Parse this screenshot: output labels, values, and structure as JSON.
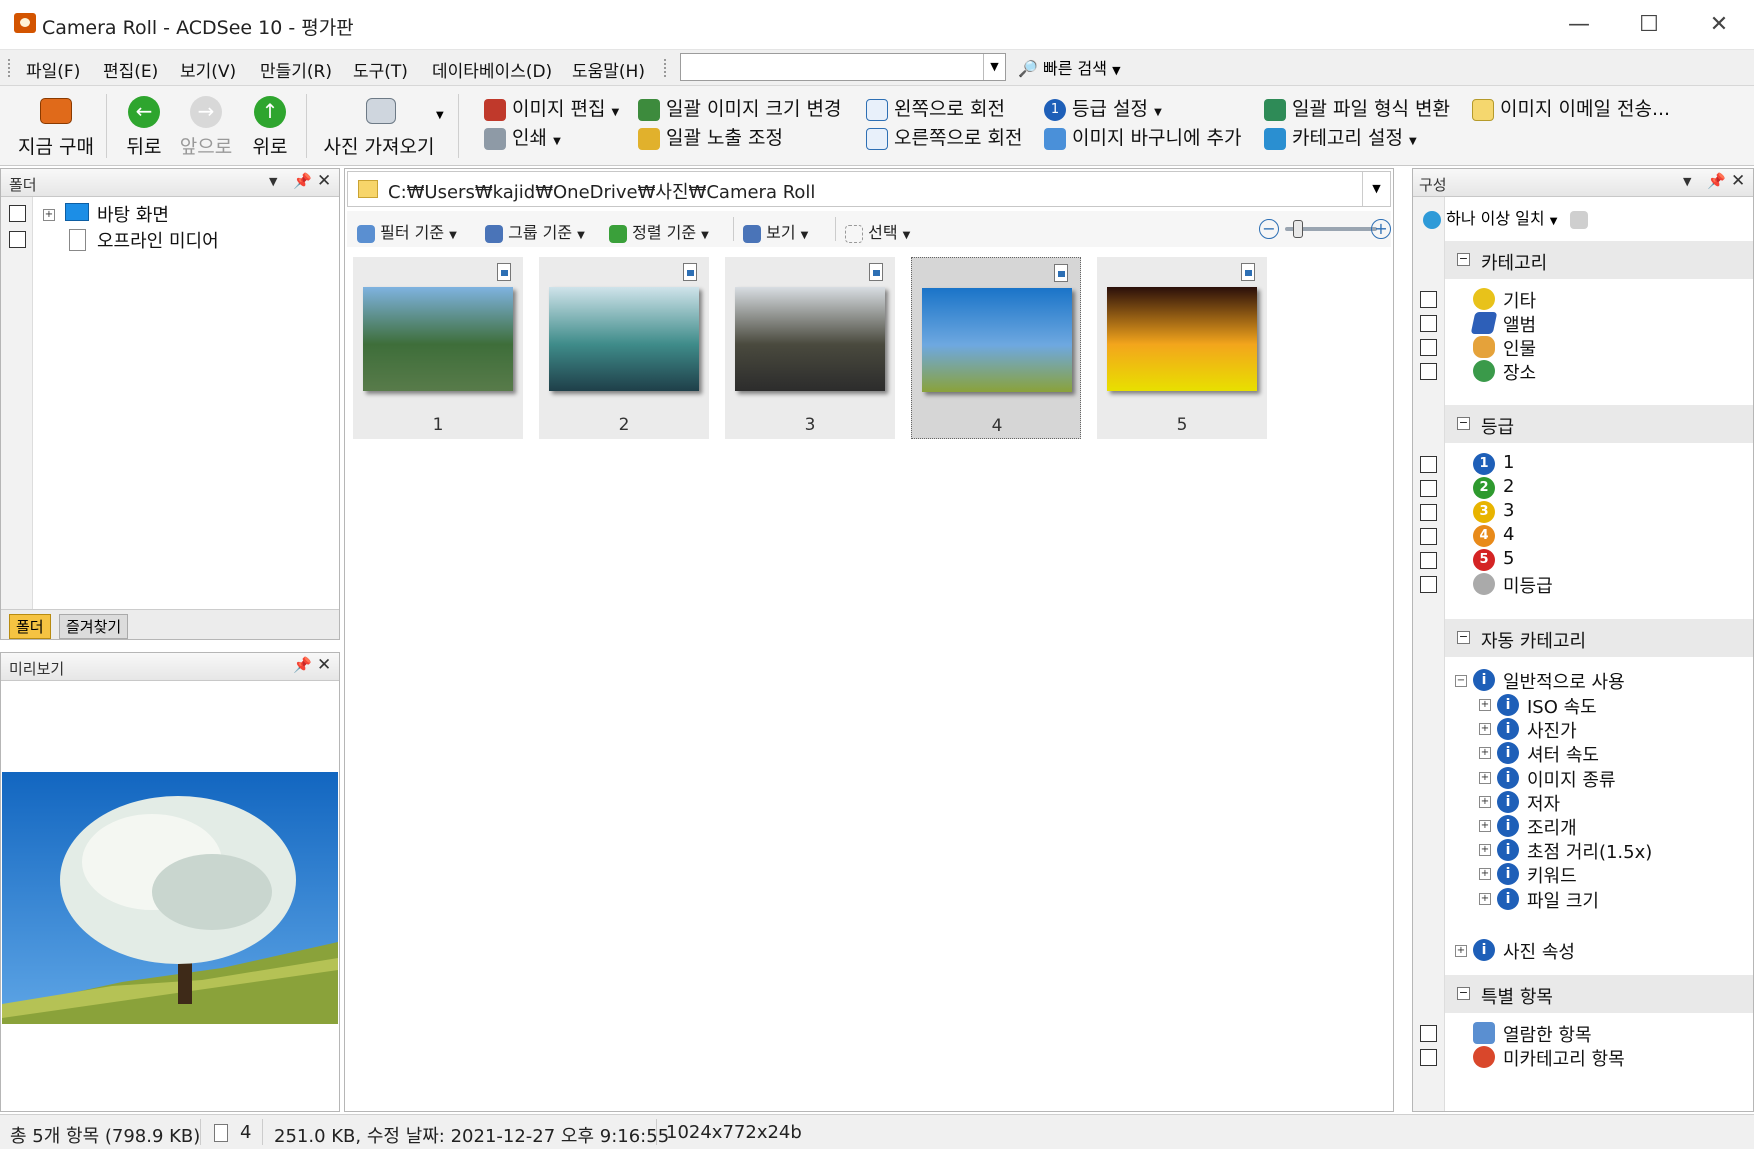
{
  "window": {
    "title": "Camera Roll - ACDSee 10 - 평가판",
    "minimize": "—",
    "maximize": "☐",
    "close": "✕"
  },
  "menu": [
    "파일(F)",
    "편집(E)",
    "보기(V)",
    "만들기(R)",
    "도구(T)",
    "데이타베이스(D)",
    "도움말(H)"
  ],
  "quick_search": {
    "value": "",
    "button": "빠른 검색"
  },
  "toolbar": {
    "buy": "지금 구매",
    "back": "뒤로",
    "forward": "앞으로",
    "up": "위로",
    "import": "사진 가져오기",
    "edit_image": "이미지 편집",
    "print": "인쇄",
    "batch_resize": "일괄 이미지 크기 변경",
    "batch_exposure": "일괄 노출 조정",
    "rotate_left": "왼쪽으로 회전",
    "rotate_right": "오른쪽으로 회전",
    "set_rating": "등급 설정",
    "add_basket": "이미지 바구니에 추가",
    "batch_convert": "일괄 파일 형식 변환",
    "set_category": "카테고리 설정",
    "email": "이미지 이메일 전송..."
  },
  "folder_panel": {
    "title": "폴더",
    "items": [
      "바탕 화면",
      "오프라인 미디어"
    ],
    "tabs": [
      "폴더",
      "즐겨찾기"
    ]
  },
  "preview_panel": {
    "title": "미리보기"
  },
  "path": "C:₩Users₩kajid₩OneDrive₩사진₩Camera Roll",
  "file_toolbar": {
    "filter": "필터 기준",
    "group": "그룹 기준",
    "sort": "정렬 기준",
    "view": "보기",
    "select": "선택",
    "zoom_level": 0.1
  },
  "thumbnails": [
    {
      "label": "1",
      "selected": false,
      "colors": [
        "#7fb3e0",
        "#3e6e3a",
        "#587b4a"
      ]
    },
    {
      "label": "2",
      "selected": false,
      "colors": [
        "#cfe3ea",
        "#3f8c8a",
        "#1f3f49"
      ]
    },
    {
      "label": "3",
      "selected": false,
      "colors": [
        "#d8dde2",
        "#4a4a3e",
        "#2c2c2c"
      ]
    },
    {
      "label": "4",
      "selected": true,
      "colors": [
        "#1a74c8",
        "#6ea8e0",
        "#8aa23a"
      ]
    },
    {
      "label": "5",
      "selected": false,
      "colors": [
        "#2a0f0a",
        "#f3a51c",
        "#e8e000"
      ]
    }
  ],
  "organize_panel": {
    "title": "구성",
    "match": "하나 이상 일치",
    "sections": {
      "category": {
        "title": "카테고리",
        "items": [
          "기타",
          "앨범",
          "인물",
          "장소"
        ]
      },
      "rating": {
        "title": "등급",
        "items": [
          "1",
          "2",
          "3",
          "4",
          "5",
          "미등급"
        ],
        "colors": [
          "#1e5fb8",
          "#2e9a2e",
          "#e8b400",
          "#e88a1a",
          "#d42424",
          "#aaaaaa"
        ]
      },
      "auto_category": {
        "title": "자동 카테고리",
        "root": "일반적으로 사용",
        "children": [
          "ISO 속도",
          "사진가",
          "셔터 속도",
          "이미지 종류",
          "저자",
          "조리개",
          "초점 거리(1.5x)",
          "키워드",
          "파일 크기"
        ],
        "photo_props": "사진 속성"
      },
      "special": {
        "title": "특별 항목",
        "items": [
          "열람한 항목",
          "미카테고리 항목"
        ]
      }
    }
  },
  "status": {
    "total": "총 5개 항목 (798.9 KB)",
    "selected": "4",
    "info": "251.0 KB, 수정 날짜: 2021-12-27 오후 9:16:55",
    "dims": "1024x772x24b"
  }
}
